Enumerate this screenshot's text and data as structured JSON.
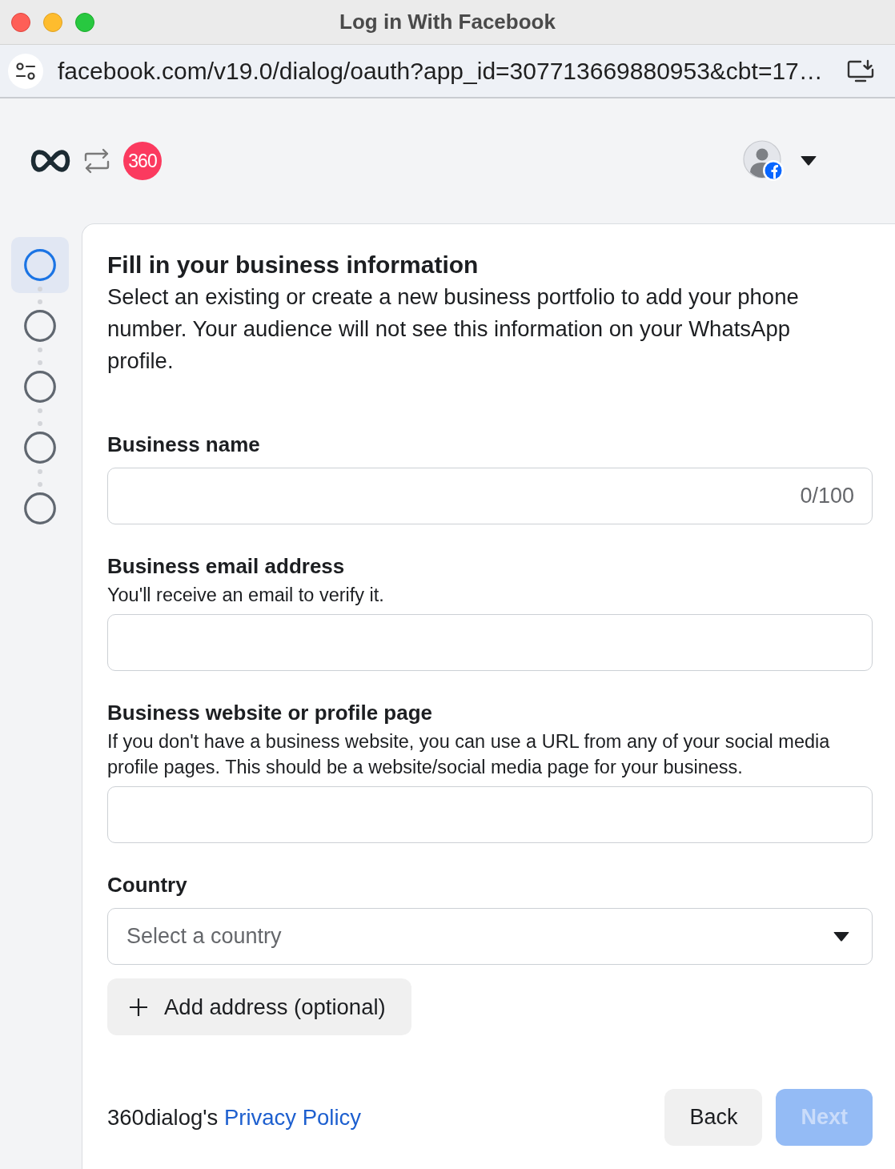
{
  "window": {
    "title": "Log in With Facebook"
  },
  "address_bar": {
    "url": "facebook.com/v19.0/dialog/oauth?app_id=307713669880953&cbt=17…"
  },
  "header": {
    "app_logo": "360"
  },
  "steps": [
    {
      "selected": true
    },
    {
      "selected": false
    },
    {
      "selected": false
    },
    {
      "selected": false
    },
    {
      "selected": false
    }
  ],
  "form": {
    "title": "Fill in your business information",
    "description": "Select an existing or create a new business portfolio to add your phone number. Your audience will not see this information on your WhatsApp profile.",
    "fields": [
      {
        "kind": "text",
        "label": "Business name",
        "counter": "0/100"
      },
      {
        "kind": "text",
        "label": "Business email address",
        "description": "You'll receive an email to verify it."
      },
      {
        "kind": "text",
        "label": "Business website or profile page",
        "description": "If you don't have a business website, you can use a URL from any of your social media profile pages. This should be a website/social media page for your business."
      },
      {
        "kind": "select",
        "label": "Country",
        "placeholder": "Select a country"
      }
    ],
    "add_address": "Add address (optional)"
  },
  "footer": {
    "privacy_prefix": "360dialog's",
    "privacy_link": "Privacy Policy",
    "buttons": [
      {
        "label": "Back",
        "kind": "secondary",
        "disabled": false
      },
      {
        "label": "Next",
        "kind": "primary",
        "disabled": true
      }
    ]
  }
}
